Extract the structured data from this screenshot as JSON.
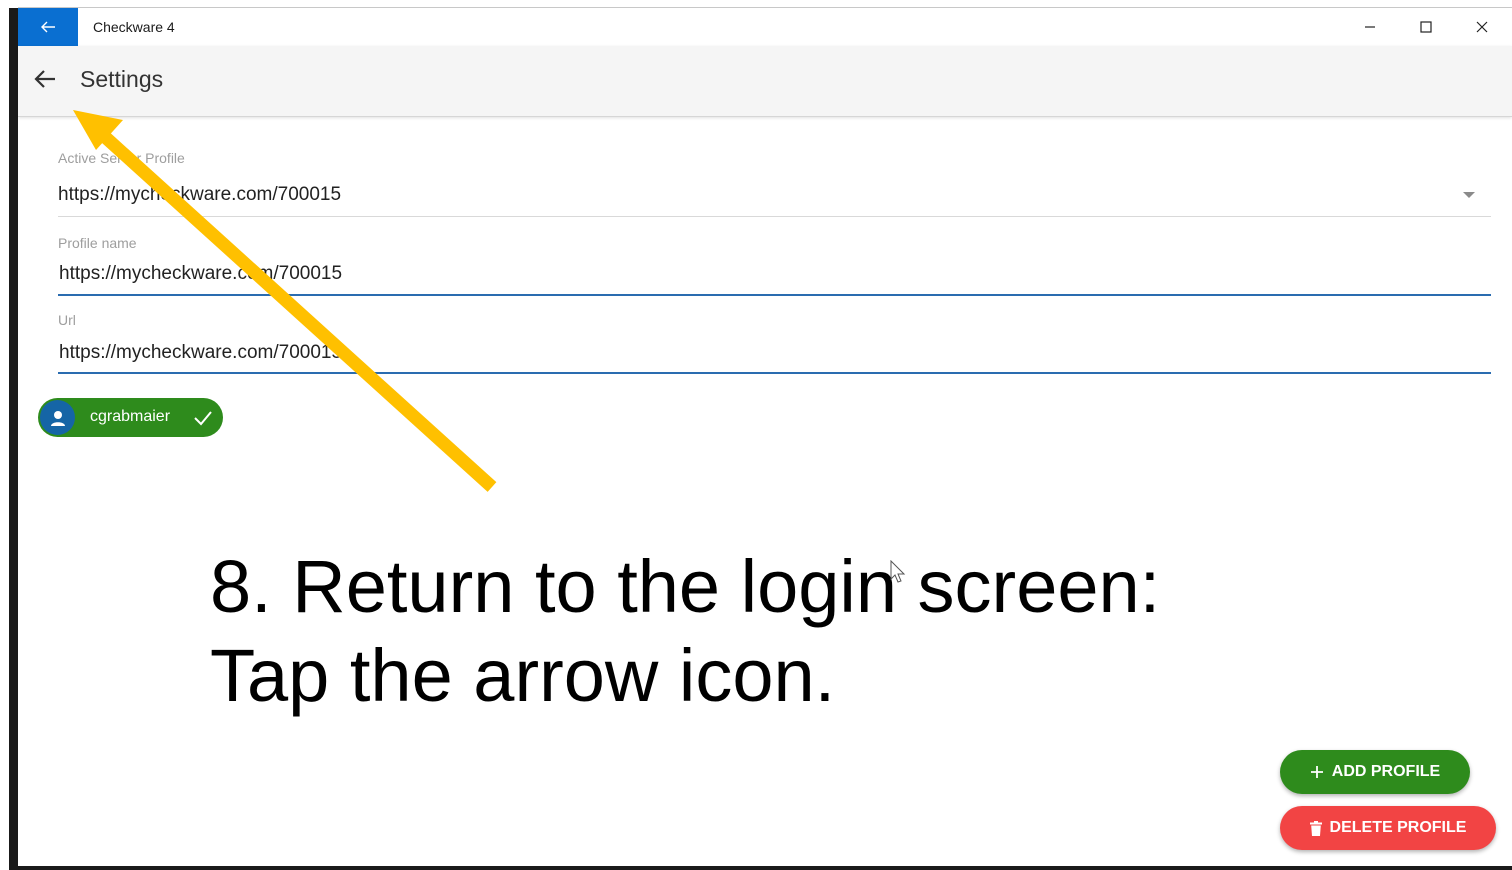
{
  "window": {
    "title": "Checkware 4"
  },
  "appbar": {
    "title": "Settings"
  },
  "form": {
    "server_profile": {
      "label": "Active Server Profile",
      "value": "https://mycheckware.com/700015"
    },
    "profile_name": {
      "label": "Profile name",
      "value": "https://mycheckware.com/700015"
    },
    "url": {
      "label": "Url",
      "value": "https://mycheckware.com/700015"
    }
  },
  "user_chip": {
    "label": "cgrabmaier",
    "icon": "person-icon",
    "status_icon": "check-icon"
  },
  "instruction": {
    "line1": "8. Return to the login screen:",
    "line2": "Tap the arrow icon."
  },
  "buttons": {
    "add_profile": "ADD PROFILE",
    "delete_profile": "DELETE PROFILE"
  },
  "colors": {
    "titlebar_accent": "#0a6fd1",
    "green": "#2e8b1c",
    "red": "#f24444",
    "field_underline_focus": "#2a6cb0",
    "annotation_arrow": "#ffc000"
  }
}
